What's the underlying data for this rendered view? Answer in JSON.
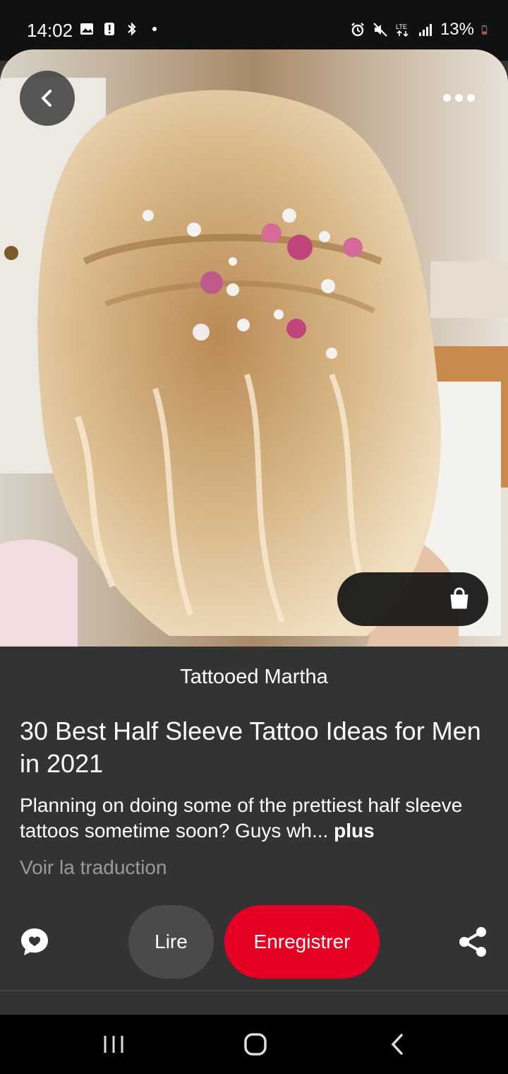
{
  "status_bar": {
    "time": "14:02",
    "battery": "13%",
    "icons_left": [
      "image-icon",
      "alert-icon",
      "bluetooth-icon",
      "dot-icon"
    ],
    "icons_right": [
      "alarm-icon",
      "mute-icon",
      "lte-icon",
      "signal-icon",
      "battery-icon"
    ]
  },
  "pin": {
    "source": "Tattooed Martha",
    "title": "30 Best Half Sleeve Tattoo Ideas for Men in 2021",
    "description": "Planning on doing some of the prettiest half sleeve tattoos sometime soon? Guys wh...",
    "more_label": "plus",
    "translate_label": "Voir la traduction"
  },
  "actions": {
    "read_label": "Lire",
    "save_label": "Enregistrer"
  },
  "colors": {
    "accent": "#e60023",
    "background": "#333333",
    "secondary_button": "#4a4a4a"
  }
}
